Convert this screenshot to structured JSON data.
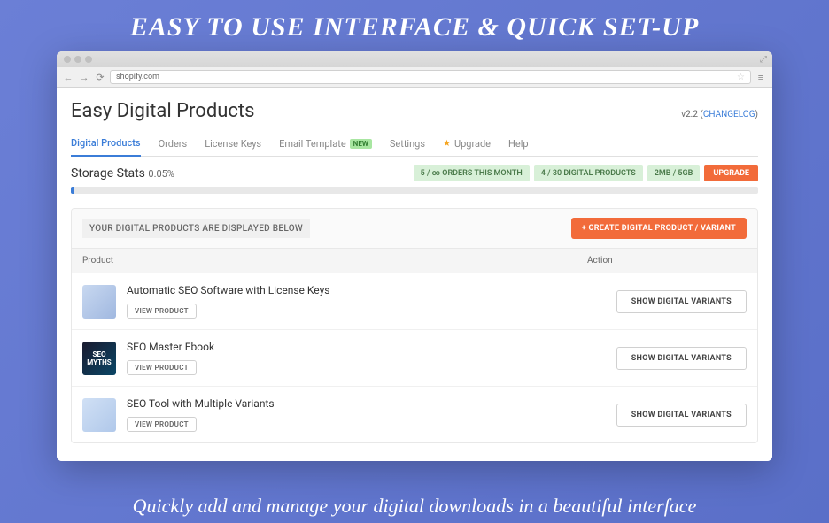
{
  "banner": {
    "title": "EASY TO USE INTERFACE & QUICK SET-UP",
    "subtitle": "Quickly add and manage your digital downloads in a beautiful interface"
  },
  "browser": {
    "url": "shopify.com"
  },
  "app": {
    "title": "Easy Digital Products",
    "version": "v2.2",
    "changelog": "CHANGELOG"
  },
  "tabs": [
    {
      "label": "Digital Products",
      "active": true
    },
    {
      "label": "Orders"
    },
    {
      "label": "License Keys"
    },
    {
      "label": "Email Template",
      "badge": "NEW"
    },
    {
      "label": "Settings"
    },
    {
      "label": "Upgrade",
      "star": true
    },
    {
      "label": "Help"
    }
  ],
  "storage": {
    "label": "Storage Stats",
    "percent": "0.05%"
  },
  "stats": [
    "5 / ∞ ORDERS THIS MONTH",
    "4 / 30 DIGITAL PRODUCTS",
    "2MB / 5GB"
  ],
  "upgrade_label": "UPGRADE",
  "section": {
    "notice": "YOUR DIGITAL PRODUCTS ARE DISPLAYED BELOW",
    "create_button": "+  CREATE DIGITAL PRODUCT / VARIANT",
    "col_product": "Product",
    "col_action": "Action",
    "view_product": "VIEW PRODUCT",
    "show_variants": "SHOW DIGITAL VARIANTS"
  },
  "products": [
    {
      "name": "Automatic SEO Software with License Keys",
      "thumb_text": ""
    },
    {
      "name": "SEO Master Ebook",
      "thumb_text": "SEO MYTHS"
    },
    {
      "name": "SEO Tool with Multiple Variants",
      "thumb_text": ""
    }
  ]
}
